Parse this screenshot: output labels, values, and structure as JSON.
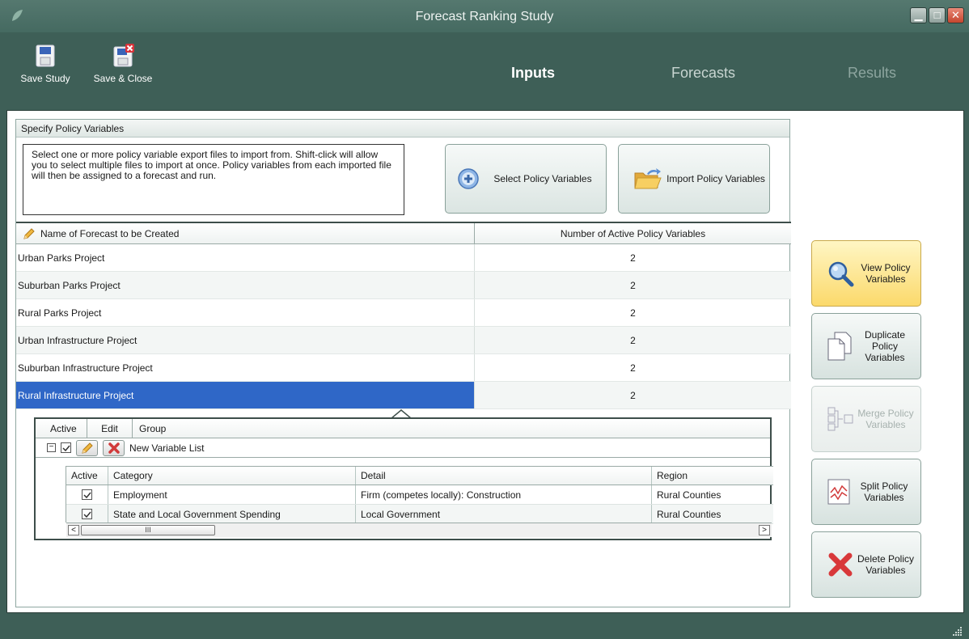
{
  "window": {
    "title": "Forecast Ranking Study"
  },
  "toolbar": {
    "save_study": "Save Study",
    "save_close": "Save & Close"
  },
  "nav": {
    "inputs": "Inputs",
    "forecasts": "Forecasts",
    "results": "Results"
  },
  "panel": {
    "title": "Specify Policy Variables",
    "description": "Select one or more policy variable export files to import from. Shift-click will allow you to select multiple files to import at once. Policy variables from each imported file will then be assigned to a forecast and run.",
    "select_button": "Select Policy Variables",
    "import_button": "Import Policy Variables"
  },
  "grid": {
    "col_name": "Name of Forecast to be Created",
    "col_count": "Number of Active Policy Variables",
    "rows": [
      {
        "name": "Urban Parks Project",
        "count": "2"
      },
      {
        "name": "Suburban Parks Project",
        "count": "2"
      },
      {
        "name": "Rural Parks Project",
        "count": "2"
      },
      {
        "name": "Urban Infrastructure Project",
        "count": "2"
      },
      {
        "name": "Suburban Infrastructure Project",
        "count": "2"
      },
      {
        "name": "Rural Infrastructure Project",
        "count": "2"
      }
    ],
    "selected_index": 5
  },
  "detail": {
    "col_active": "Active",
    "col_edit": "Edit",
    "col_group": "Group",
    "group_name": "New Variable List",
    "expander": "−",
    "inner_cols": {
      "active": "Active",
      "category": "Category",
      "detail": "Detail",
      "region": "Region"
    },
    "rows": [
      {
        "category": "Employment",
        "detail": "Firm (competes locally): Construction",
        "region": "Rural Counties"
      },
      {
        "category": "State and Local Government Spending",
        "detail": "Local Government",
        "region": "Rural Counties"
      }
    ],
    "scroll_left": "<",
    "scroll_right": ">",
    "scroll_thumb": "III"
  },
  "side_buttons": {
    "view": "View Policy Variables",
    "duplicate": "Duplicate Policy Variables",
    "merge": "Merge Policy Variables",
    "split": "Split Policy Variables",
    "delete": "Delete Policy Variables"
  },
  "colors": {
    "frame": "#3e5f57",
    "selection": "#2f67c7",
    "highlight": "#fbd96b"
  }
}
